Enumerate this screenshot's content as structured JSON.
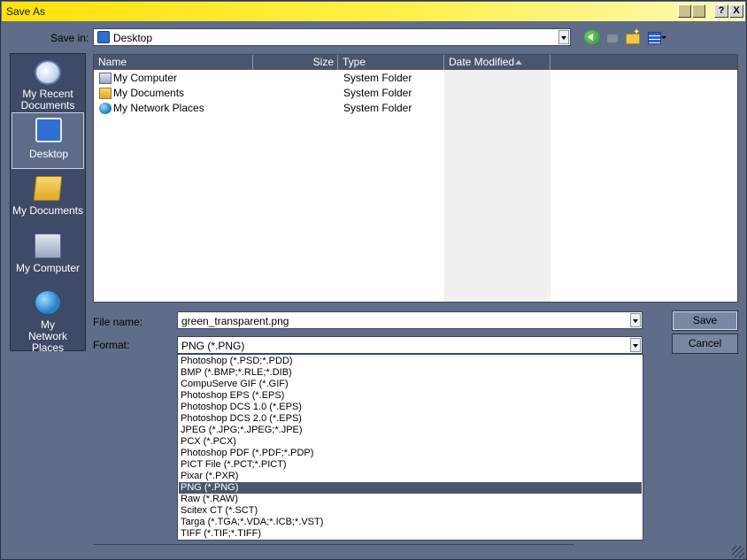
{
  "window": {
    "title": "Save As"
  },
  "titlebar": {
    "help_label": "?",
    "close_label": "X"
  },
  "save_in": {
    "label": "Save in:",
    "value": "Desktop"
  },
  "places": [
    {
      "label": "My Recent Documents",
      "icon": "recent-documents-icon"
    },
    {
      "label": "Desktop",
      "icon": "desktop-icon",
      "selected": true
    },
    {
      "label": "My Documents",
      "icon": "my-documents-icon"
    },
    {
      "label": "My Computer",
      "icon": "my-computer-icon"
    },
    {
      "label": "My Network Places",
      "icon": "network-places-icon"
    }
  ],
  "file_list": {
    "columns": [
      "Name",
      "Size",
      "Type",
      "Date Modified"
    ],
    "rows": [
      {
        "name": "My Computer",
        "size": "",
        "type": "System Folder",
        "icon": "my-computer-icon"
      },
      {
        "name": "My Documents",
        "size": "",
        "type": "System Folder",
        "icon": "my-documents-icon"
      },
      {
        "name": "My Network Places",
        "size": "",
        "type": "System Folder",
        "icon": "network-places-icon"
      }
    ]
  },
  "file_name": {
    "label": "File name:",
    "value": "green_transparent.png"
  },
  "format": {
    "label": "Format:",
    "value": "PNG (*.PNG)",
    "options": [
      "Photoshop (*.PSD;*.PDD)",
      "BMP (*.BMP;*.RLE;*.DIB)",
      "CompuServe GIF (*.GIF)",
      "Photoshop EPS (*.EPS)",
      "Photoshop DCS 1.0 (*.EPS)",
      "Photoshop DCS 2.0 (*.EPS)",
      "JPEG (*.JPG;*.JPEG;*.JPE)",
      "PCX (*.PCX)",
      "Photoshop PDF (*.PDF;*.PDP)",
      "PICT File (*.PCT;*.PICT)",
      "Pixar (*.PXR)",
      "PNG (*.PNG)",
      "Raw (*.RAW)",
      "Scitex CT (*.SCT)",
      "Targa (*.TGA;*.VDA;*.ICB;*.VST)",
      "TIFF (*.TIF;*.TIFF)"
    ],
    "selected_index": 11
  },
  "buttons": {
    "save": "Save",
    "cancel": "Cancel"
  },
  "colors": {
    "titlebar": "#ffe20a",
    "window_bg": "#5f6d88",
    "places_bg": "#3e4a66",
    "selection": "#4b566d"
  }
}
